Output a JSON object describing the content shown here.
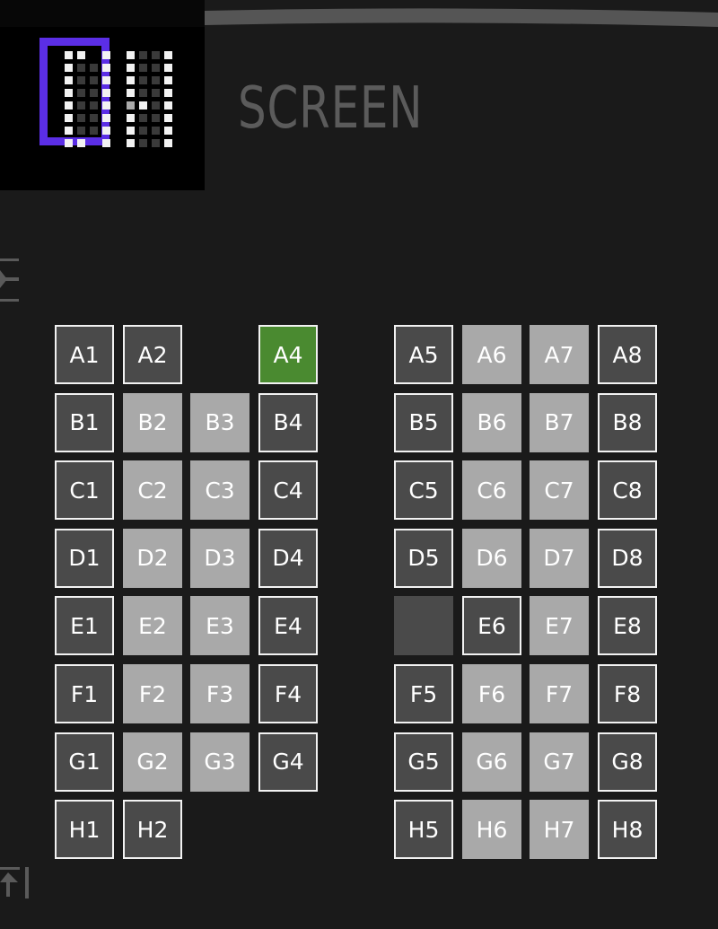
{
  "logo": {
    "accent_color": "#5b2ee6"
  },
  "screen": {
    "label": "SCREEN"
  },
  "icons": {
    "top": "arrow-left-to-bar-icon",
    "bottom": "arrow-up-to-bar-icon"
  },
  "colors": {
    "available": "#4a4a4a",
    "occupied": "#a9a9a9",
    "selected": "#4a8a30"
  },
  "rows": [
    {
      "seats": [
        {
          "label": "A1",
          "state": "available"
        },
        {
          "label": "A2",
          "state": "available"
        },
        null,
        {
          "label": "A4",
          "state": "selected"
        },
        {
          "label": "A5",
          "state": "available"
        },
        {
          "label": "A6",
          "state": "occupied"
        },
        {
          "label": "A7",
          "state": "occupied"
        },
        {
          "label": "A8",
          "state": "available"
        }
      ]
    },
    {
      "seats": [
        {
          "label": "B1",
          "state": "available"
        },
        {
          "label": "B2",
          "state": "occupied"
        },
        {
          "label": "B3",
          "state": "occupied"
        },
        {
          "label": "B4",
          "state": "available"
        },
        {
          "label": "B5",
          "state": "available"
        },
        {
          "label": "B6",
          "state": "occupied"
        },
        {
          "label": "B7",
          "state": "occupied"
        },
        {
          "label": "B8",
          "state": "available"
        }
      ]
    },
    {
      "seats": [
        {
          "label": "C1",
          "state": "available"
        },
        {
          "label": "C2",
          "state": "occupied"
        },
        {
          "label": "C3",
          "state": "occupied"
        },
        {
          "label": "C4",
          "state": "available"
        },
        {
          "label": "C5",
          "state": "available"
        },
        {
          "label": "C6",
          "state": "occupied"
        },
        {
          "label": "C7",
          "state": "occupied"
        },
        {
          "label": "C8",
          "state": "available"
        }
      ]
    },
    {
      "seats": [
        {
          "label": "D1",
          "state": "available"
        },
        {
          "label": "D2",
          "state": "occupied"
        },
        {
          "label": "D3",
          "state": "occupied"
        },
        {
          "label": "D4",
          "state": "available"
        },
        {
          "label": "D5",
          "state": "available"
        },
        {
          "label": "D6",
          "state": "occupied"
        },
        {
          "label": "D7",
          "state": "occupied"
        },
        {
          "label": "D8",
          "state": "available"
        }
      ]
    },
    {
      "seats": [
        {
          "label": "E1",
          "state": "available"
        },
        {
          "label": "E2",
          "state": "occupied"
        },
        {
          "label": "E3",
          "state": "occupied"
        },
        {
          "label": "E4",
          "state": "available"
        },
        {
          "label": "",
          "state": "disabled"
        },
        {
          "label": "E6",
          "state": "available"
        },
        {
          "label": "E7",
          "state": "occupied"
        },
        {
          "label": "E8",
          "state": "available"
        }
      ]
    },
    {
      "seats": [
        {
          "label": "F1",
          "state": "available"
        },
        {
          "label": "F2",
          "state": "occupied"
        },
        {
          "label": "F3",
          "state": "occupied"
        },
        {
          "label": "F4",
          "state": "available"
        },
        {
          "label": "F5",
          "state": "available"
        },
        {
          "label": "F6",
          "state": "occupied"
        },
        {
          "label": "F7",
          "state": "occupied"
        },
        {
          "label": "F8",
          "state": "available"
        }
      ]
    },
    {
      "seats": [
        {
          "label": "G1",
          "state": "available"
        },
        {
          "label": "G2",
          "state": "occupied"
        },
        {
          "label": "G3",
          "state": "occupied"
        },
        {
          "label": "G4",
          "state": "available"
        },
        {
          "label": "G5",
          "state": "available"
        },
        {
          "label": "G6",
          "state": "occupied"
        },
        {
          "label": "G7",
          "state": "occupied"
        },
        {
          "label": "G8",
          "state": "available"
        }
      ]
    },
    {
      "seats": [
        {
          "label": "H1",
          "state": "available"
        },
        {
          "label": "H2",
          "state": "available"
        },
        null,
        null,
        {
          "label": "H5",
          "state": "available"
        },
        {
          "label": "H6",
          "state": "occupied"
        },
        {
          "label": "H7",
          "state": "occupied"
        },
        {
          "label": "H8",
          "state": "available"
        }
      ]
    }
  ]
}
